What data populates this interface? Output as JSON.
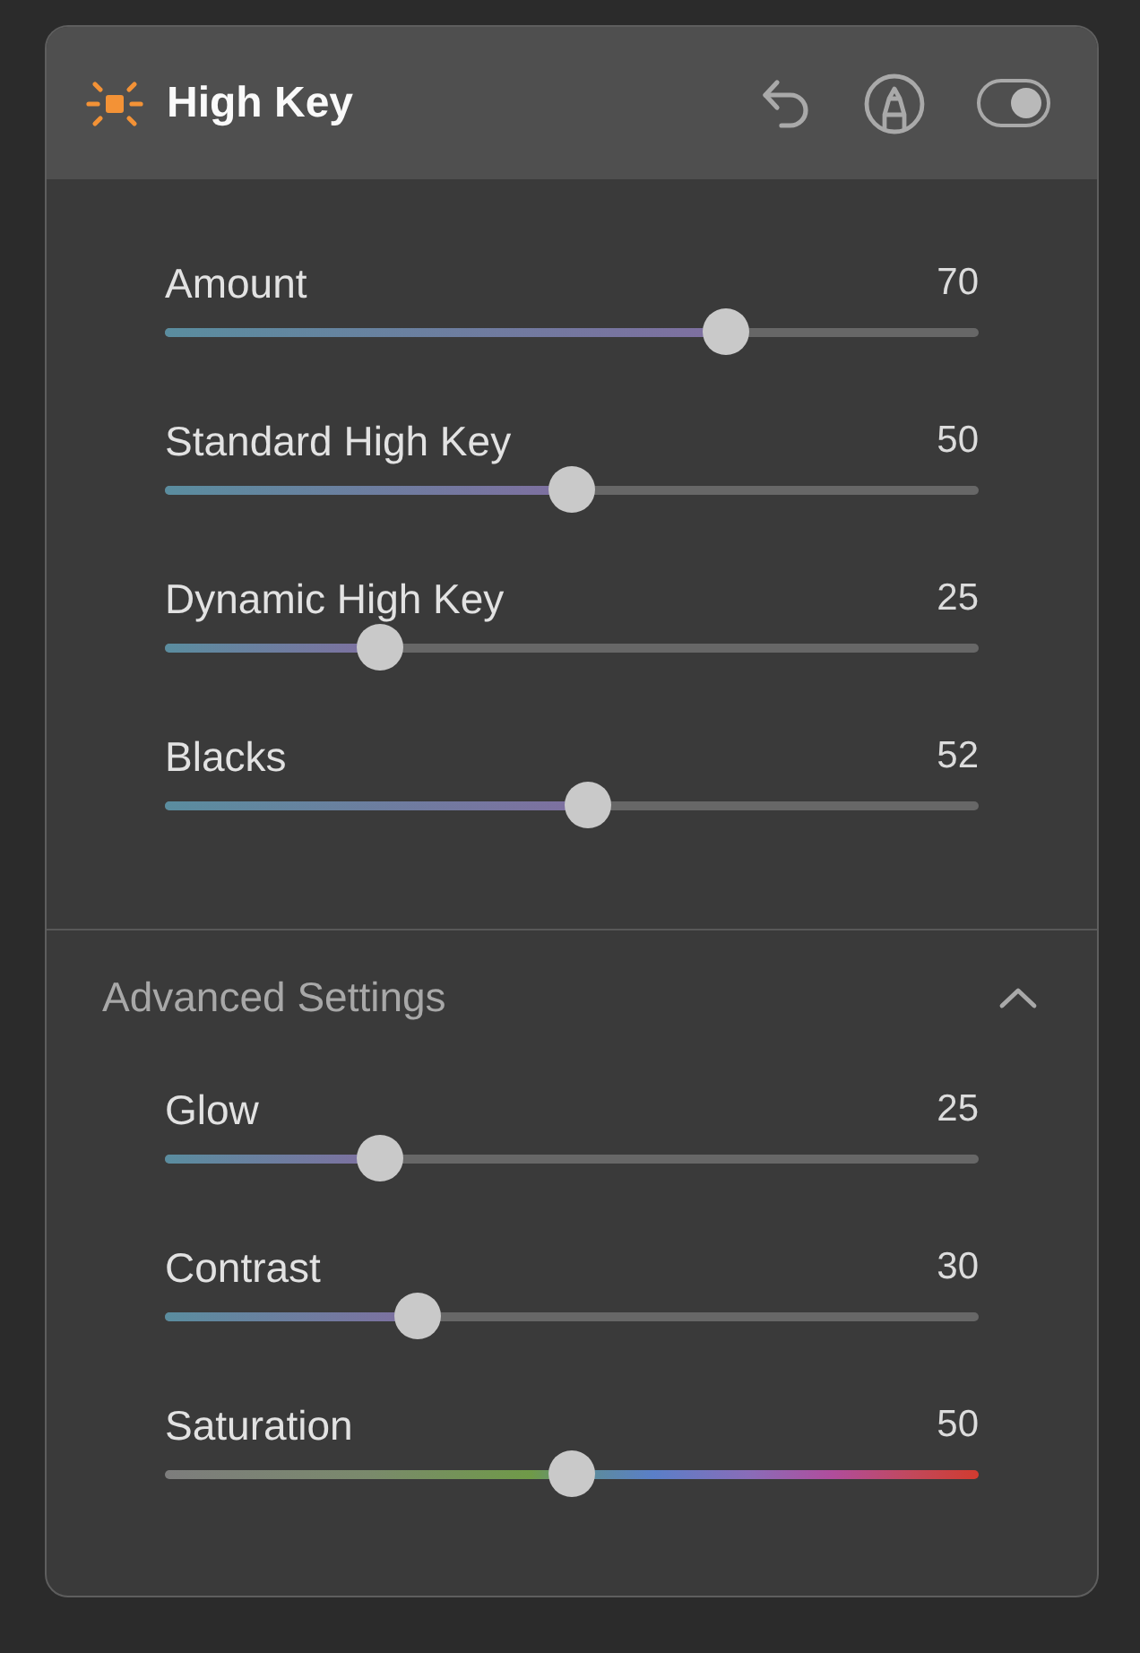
{
  "panel": {
    "title": "High Key",
    "enabled": true
  },
  "sliders": [
    {
      "label": "Amount",
      "value": "70",
      "level": 0.7,
      "kind": "standard"
    },
    {
      "label": "Standard High Key",
      "value": "50",
      "level": 0.5,
      "kind": "standard"
    },
    {
      "label": "Dynamic High Key",
      "value": "25",
      "level": 0.25,
      "kind": "standard"
    },
    {
      "label": "Blacks",
      "value": "52",
      "level": 0.52,
      "kind": "standard"
    }
  ],
  "advanced": {
    "title": "Advanced Settings",
    "expanded": true,
    "sliders": [
      {
        "label": "Glow",
        "value": "25",
        "level": 0.25,
        "kind": "standard"
      },
      {
        "label": "Contrast",
        "value": "30",
        "level": 0.3,
        "kind": "standard"
      },
      {
        "label": "Saturation",
        "value": "50",
        "level": 0.5,
        "kind": "spectrum"
      }
    ]
  }
}
